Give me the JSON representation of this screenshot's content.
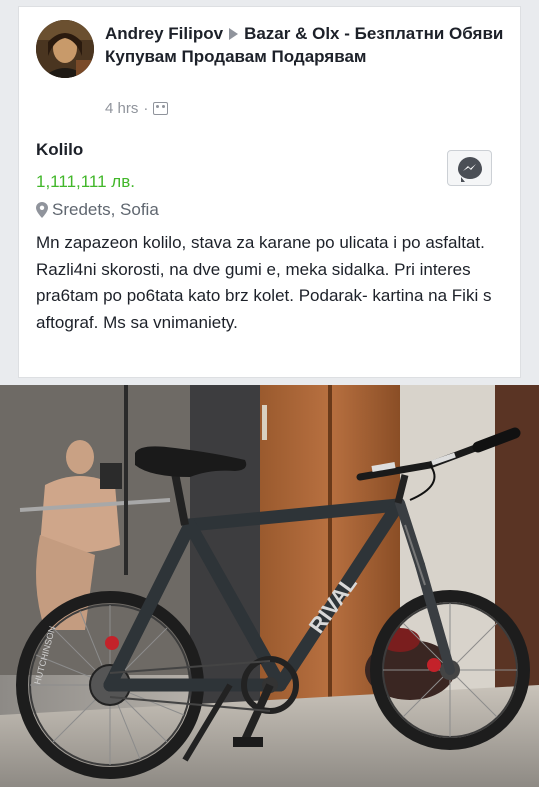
{
  "post": {
    "author": "Andrey Filipov",
    "group": "Bazar & Olx - Безплатни Обяви Купувам Продавам Подарявам",
    "time": "4 hrs",
    "privacy_icon": "group-icon"
  },
  "listing": {
    "title": "Kolilo",
    "price": "1,111,111 лв.",
    "location": "Sredets, Sofia",
    "description": "Mn zapazeon kolilo, stava za karane po ulicata i po asfaltat. Razli4ni skorosti, na dve gumi e, meka sidalka. Pri interes pra6tam po po6tata kato brz kolet. Podarak- kartina na Fiki s aftograf. Ms sa vnimaniety.",
    "price_color": "#42b72a"
  },
  "photo": {
    "frame_text": "RIVAL",
    "tire_text": "HUTCHINSON"
  }
}
